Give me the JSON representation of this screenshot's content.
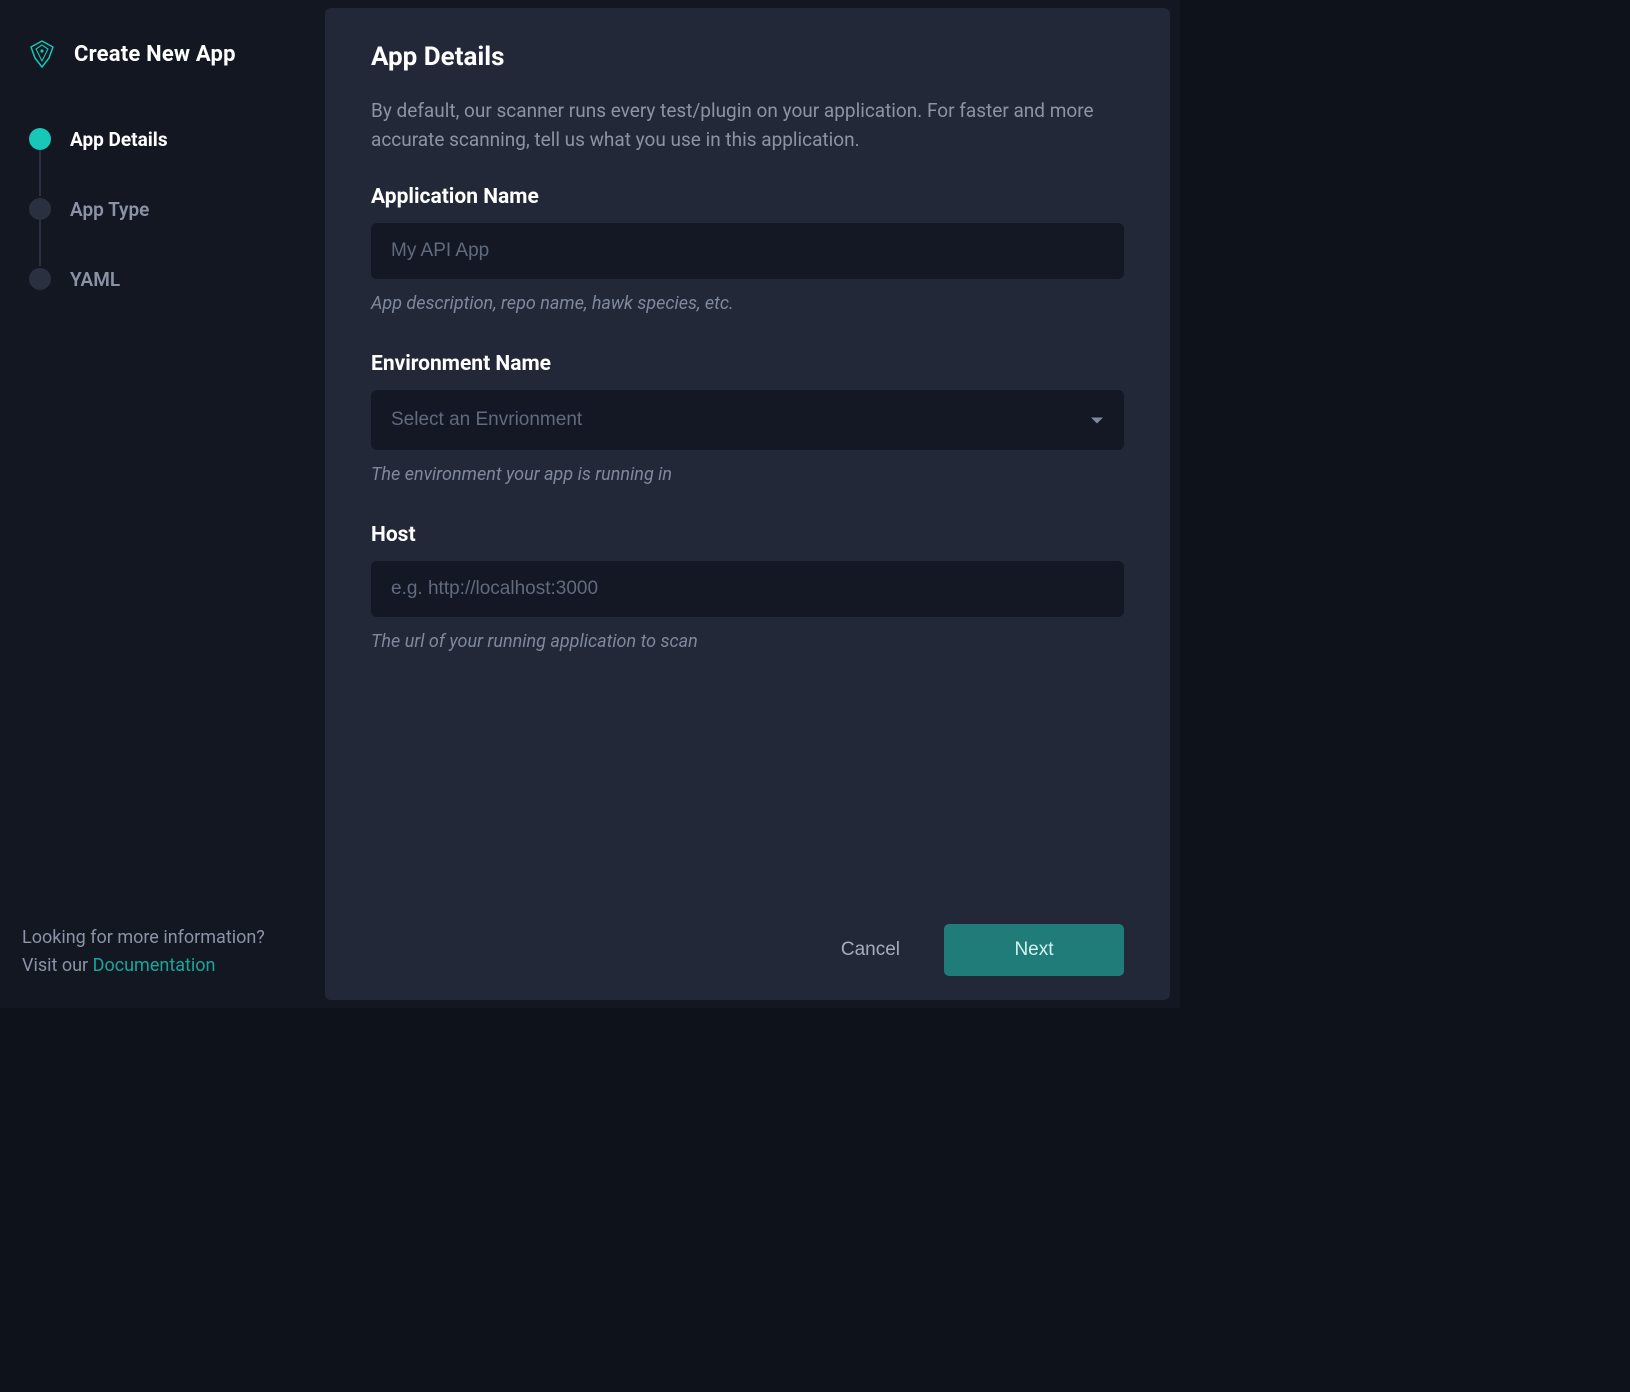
{
  "sidebar": {
    "brand_title": "Create New App",
    "steps": [
      {
        "label": "App Details",
        "active": true
      },
      {
        "label": "App Type",
        "active": false
      },
      {
        "label": "YAML",
        "active": false
      }
    ],
    "footer": {
      "line1": "Looking for more information?",
      "line2_prefix": "Visit our ",
      "link_label": "Documentation"
    }
  },
  "main": {
    "title": "App Details",
    "description": "By default, our scanner runs every test/plugin on your application. For faster and more accurate scanning, tell us what you use in this application.",
    "fields": {
      "app_name": {
        "label": "Application Name",
        "placeholder": "My API App",
        "value": "",
        "help": "App description, repo name, hawk species, etc."
      },
      "env_name": {
        "label": "Environment Name",
        "placeholder": "Select an Envrionment",
        "value": "",
        "help": "The environment your app is running in"
      },
      "host": {
        "label": "Host",
        "placeholder": "e.g. http://localhost:3000",
        "value": "",
        "help": "The url of your running application to scan"
      }
    },
    "actions": {
      "cancel": "Cancel",
      "next": "Next"
    }
  },
  "colors": {
    "accent": "#17c7b7",
    "panel": "#222838",
    "bg": "#121722",
    "input_bg": "#131824",
    "muted": "#8b93a5"
  }
}
